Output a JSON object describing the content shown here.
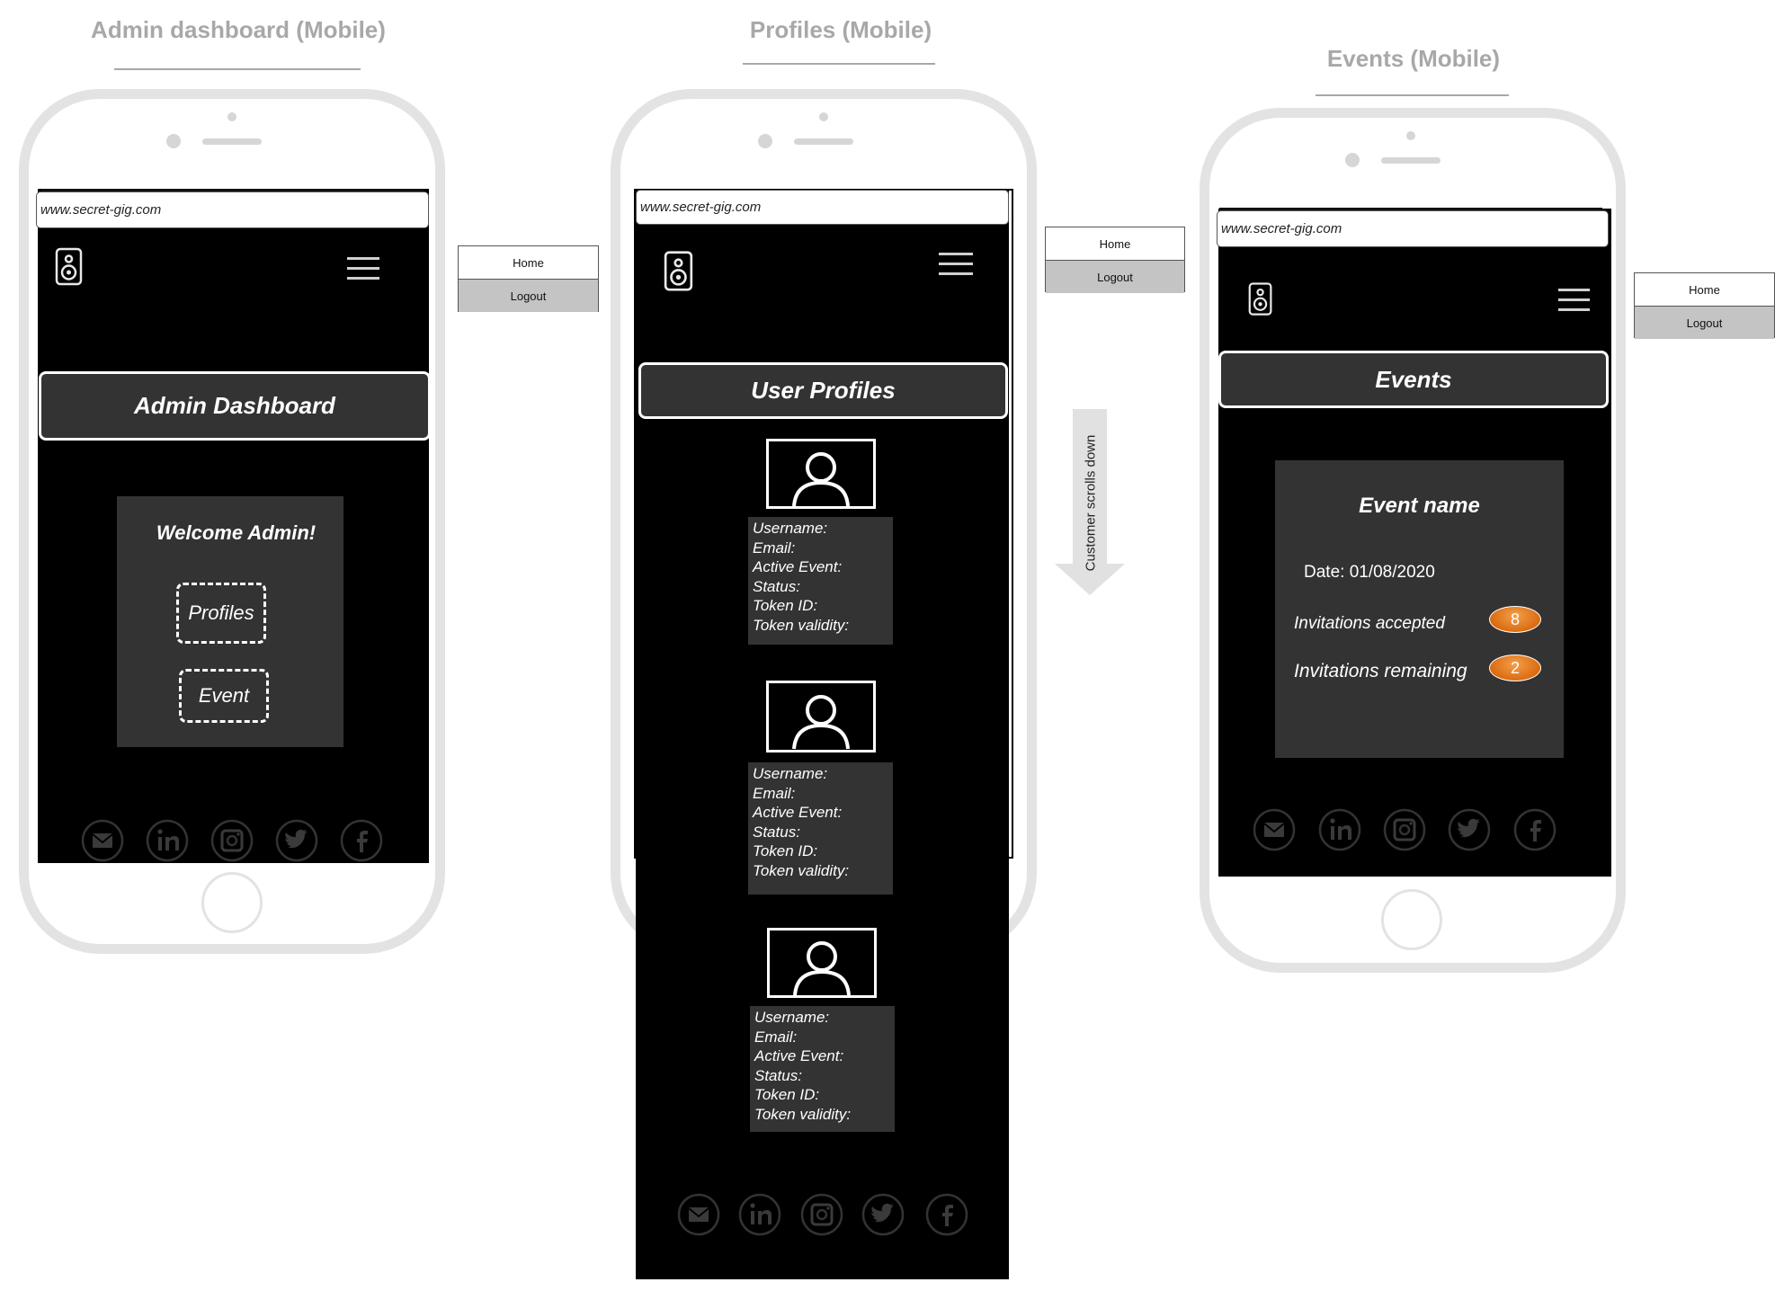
{
  "columns": {
    "admin": {
      "title": "Admin dashboard (Mobile)"
    },
    "profiles": {
      "title": "Profiles (Mobile)"
    },
    "events": {
      "title": "Events (Mobile)"
    }
  },
  "browser": {
    "url": "www.secret-gig.com"
  },
  "menu": {
    "home_label": "Home",
    "logout_label": "Logout"
  },
  "admin_screen": {
    "header": "Admin Dashboard",
    "welcome": "Welcome Admin!",
    "profiles_button": "Profiles",
    "event_button": "Event"
  },
  "profiles_screen": {
    "header": "User Profiles",
    "scroll_note": "Customer scrolls down",
    "card_fields": [
      "Username:",
      "Email:",
      "Active Event:",
      "Status:",
      "Token ID:",
      "Token validity:"
    ],
    "card_count": 3
  },
  "events_screen": {
    "header": "Events",
    "event_name": "Event name",
    "date_text": "Date: 01/08/2020",
    "accepted_label": "Invitations accepted",
    "accepted_count": "8",
    "remaining_label": "Invitations remaining",
    "remaining_count": "2"
  },
  "icons": {
    "logo": "speaker-icon",
    "menu": "hamburger-menu-icon",
    "profile": "user-avatar-icon",
    "social": [
      "email-icon",
      "linkedin-icon",
      "instagram-icon",
      "twitter-icon",
      "facebook-icon"
    ]
  },
  "colors": {
    "screen": "#000000",
    "panel": "#333333",
    "accent": "#e57d1e",
    "frame": "#e3e3e3",
    "title": "#a8a8a8"
  }
}
